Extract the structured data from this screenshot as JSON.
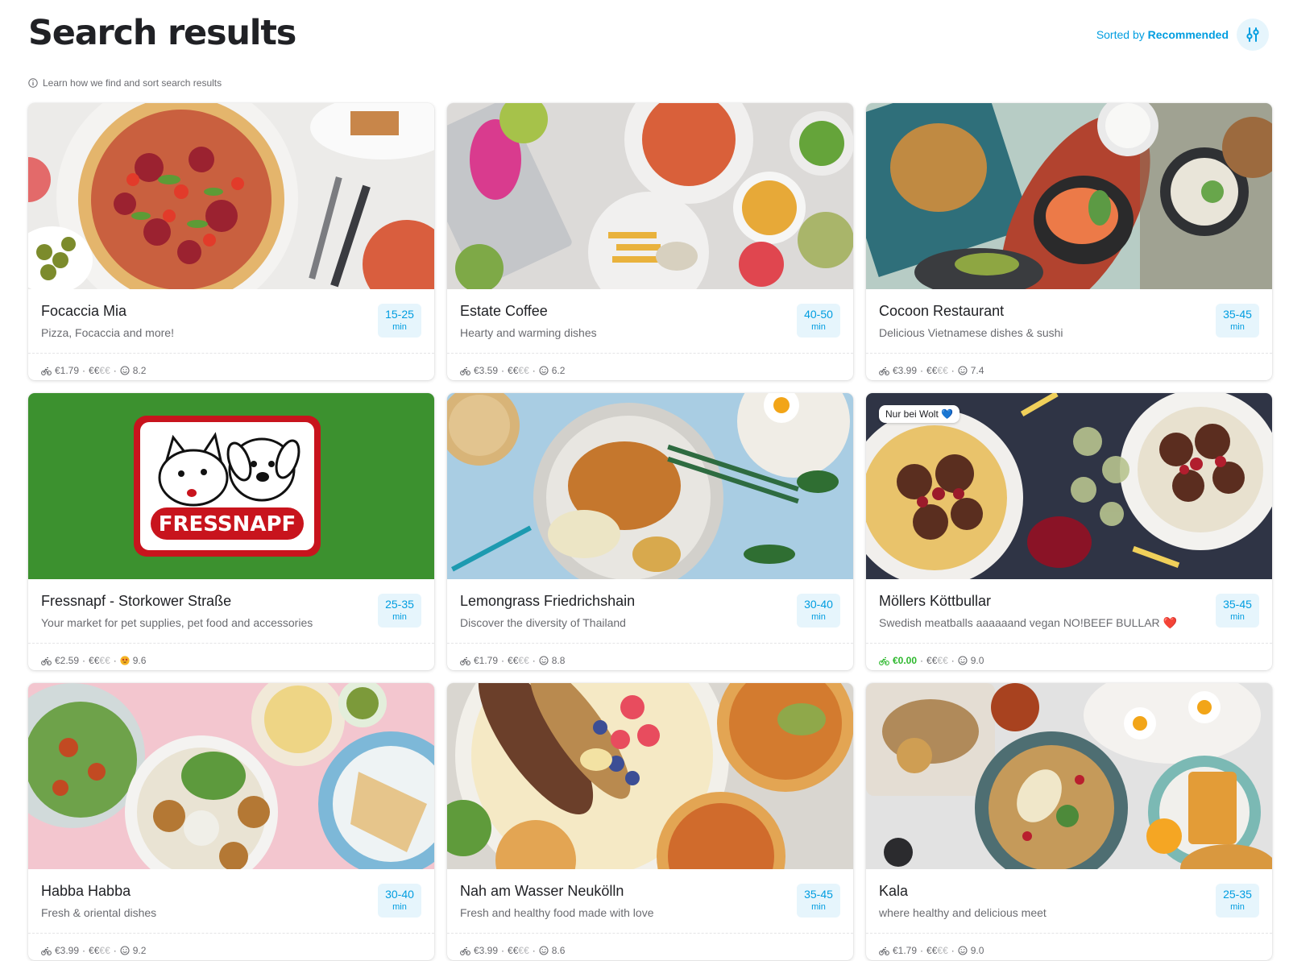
{
  "header": {
    "title": "Search results",
    "sort_prefix": "Sorted by",
    "sort_value": "Recommended",
    "sort_icon": "sliders-icon"
  },
  "info": {
    "text": "Learn how we find and sort search results",
    "icon": "info-icon"
  },
  "colors": {
    "accent": "#009de0",
    "accent_bg": "#e6f5fc",
    "free_delivery": "#2eb82e"
  },
  "venues": [
    {
      "name": "Focaccia Mia",
      "desc": "Pizza, Focaccia and more!",
      "eta": "15-25",
      "eta_unit": "min",
      "fee": "€1.79",
      "price": "€€",
      "price_dim": "€€",
      "rating": "8.2",
      "rating_icon": "smiley-icon"
    },
    {
      "name": "Estate Coffee",
      "desc": "Hearty and warming dishes",
      "eta": "40-50",
      "eta_unit": "min",
      "fee": "€3.59",
      "price": "€€",
      "price_dim": "€€",
      "rating": "6.2",
      "rating_icon": "smiley-icon"
    },
    {
      "name": "Cocoon Restaurant",
      "desc": "Delicious Vietnamese dishes & sushi",
      "eta": "35-45",
      "eta_unit": "min",
      "fee": "€3.99",
      "price": "€€",
      "price_dim": "€€",
      "rating": "7.4",
      "rating_icon": "smiley-icon"
    },
    {
      "name": "Fressnapf - Storkower Straße",
      "desc": "Your market for pet supplies, pet food and accessories",
      "eta": "25-35",
      "eta_unit": "min",
      "fee": "€2.59",
      "price": "€€",
      "price_dim": "€€",
      "rating": "9.6",
      "rating_icon": "star-eyes-emoji-icon",
      "logo_text": "FRESSNAPF"
    },
    {
      "name": "Lemongrass Friedrichshain",
      "desc": "Discover the diversity of Thailand",
      "eta": "30-40",
      "eta_unit": "min",
      "fee": "€1.79",
      "price": "€€",
      "price_dim": "€€",
      "rating": "8.8",
      "rating_icon": "smiley-icon"
    },
    {
      "name": "Möllers Köttbullar",
      "desc": "Swedish meatballs aaaaaand vegan NO!BEEF BULLAR ❤️",
      "eta": "35-45",
      "eta_unit": "min",
      "fee": "€0.00",
      "price": "€€",
      "price_dim": "€€",
      "rating": "9.0",
      "rating_icon": "smiley-icon",
      "badge": "Nur bei Wolt 💙"
    },
    {
      "name": "Habba Habba",
      "desc": "Fresh & oriental dishes",
      "eta": "30-40",
      "eta_unit": "min",
      "fee": "€3.99",
      "price": "€€",
      "price_dim": "€€",
      "rating": "9.2",
      "rating_icon": "smiley-icon"
    },
    {
      "name": "Nah am Wasser Neukölln",
      "desc": "Fresh and healthy food made with love",
      "eta": "35-45",
      "eta_unit": "min",
      "fee": "€3.99",
      "price": "€€",
      "price_dim": "€€",
      "rating": "8.6",
      "rating_icon": "smiley-icon"
    },
    {
      "name": "Kala",
      "desc": "where healthy and delicious meet",
      "eta": "25-35",
      "eta_unit": "min",
      "fee": "€1.79",
      "price": "€€",
      "price_dim": "€€",
      "rating": "9.0",
      "rating_icon": "smiley-icon"
    }
  ]
}
